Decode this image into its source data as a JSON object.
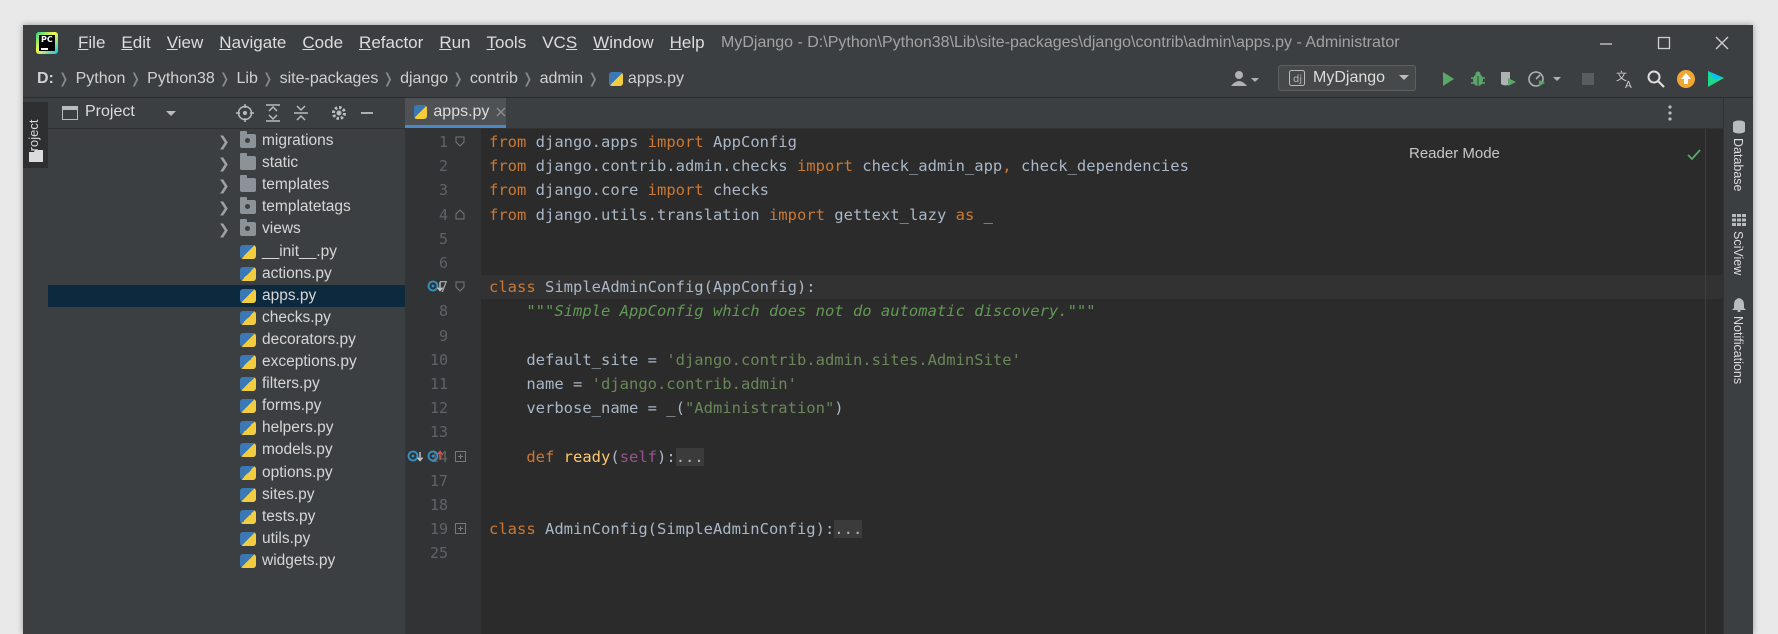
{
  "window": {
    "title": "MyDjango - D:\\Python\\Python38\\Lib\\site-packages\\django\\contrib\\admin\\apps.py - Administrator",
    "logo_text": "PC"
  },
  "menu": [
    {
      "mnemonic": "F",
      "rest": "ile"
    },
    {
      "mnemonic": "E",
      "rest": "dit"
    },
    {
      "mnemonic": "V",
      "rest": "iew"
    },
    {
      "mnemonic": "N",
      "rest": "avigate"
    },
    {
      "mnemonic": "C",
      "rest": "ode"
    },
    {
      "mnemonic": "R",
      "rest": "efactor"
    },
    {
      "mnemonic": "R",
      "rest": "un",
      "pre": ""
    },
    {
      "mnemonic": "T",
      "rest": "ools"
    },
    {
      "pre": "VC",
      "mnemonic": "S",
      "rest": ""
    },
    {
      "mnemonic": "W",
      "rest": "indow"
    },
    {
      "mnemonic": "H",
      "rest": "elp"
    }
  ],
  "breadcrumbs": [
    "D:",
    "Python",
    "Python38",
    "Lib",
    "site-packages",
    "django",
    "contrib",
    "admin",
    "apps.py"
  ],
  "run_config": {
    "label": "MyDjango"
  },
  "project_panel": {
    "title": "Project"
  },
  "left_stripe": {
    "project_label": "Project"
  },
  "tree": [
    {
      "name": "migrations",
      "type": "package"
    },
    {
      "name": "static",
      "type": "folder"
    },
    {
      "name": "templates",
      "type": "folder"
    },
    {
      "name": "templatetags",
      "type": "package"
    },
    {
      "name": "views",
      "type": "package"
    },
    {
      "name": "__init__.py",
      "type": "file"
    },
    {
      "name": "actions.py",
      "type": "file"
    },
    {
      "name": "apps.py",
      "type": "file",
      "selected": true
    },
    {
      "name": "checks.py",
      "type": "file"
    },
    {
      "name": "decorators.py",
      "type": "file"
    },
    {
      "name": "exceptions.py",
      "type": "file"
    },
    {
      "name": "filters.py",
      "type": "file"
    },
    {
      "name": "forms.py",
      "type": "file"
    },
    {
      "name": "helpers.py",
      "type": "file"
    },
    {
      "name": "models.py",
      "type": "file"
    },
    {
      "name": "options.py",
      "type": "file"
    },
    {
      "name": "sites.py",
      "type": "file"
    },
    {
      "name": "tests.py",
      "type": "file"
    },
    {
      "name": "utils.py",
      "type": "file"
    },
    {
      "name": "widgets.py",
      "type": "file"
    }
  ],
  "editor": {
    "tab": "apps.py",
    "reader_mode": "Reader Mode",
    "current_line": "7",
    "line_numbers": [
      "1",
      "2",
      "3",
      "4",
      "5",
      "6",
      "7",
      "8",
      "9",
      "10",
      "11",
      "12",
      "13",
      "14",
      "17",
      "18",
      "19",
      "25"
    ],
    "lines": [
      [
        {
          "t": "from",
          "c": "kw"
        },
        {
          "t": " django.apps "
        },
        {
          "t": "import",
          "c": "kw"
        },
        {
          "t": " AppConfig"
        }
      ],
      [
        {
          "t": "from",
          "c": "kw"
        },
        {
          "t": " django.contrib.admin.checks "
        },
        {
          "t": "import",
          "c": "kw"
        },
        {
          "t": " check_admin_app"
        },
        {
          "t": ",",
          "c": "kw"
        },
        {
          "t": " check_dependencies"
        }
      ],
      [
        {
          "t": "from",
          "c": "kw"
        },
        {
          "t": " django.core "
        },
        {
          "t": "import",
          "c": "kw"
        },
        {
          "t": " checks"
        }
      ],
      [
        {
          "t": "from",
          "c": "kw"
        },
        {
          "t": " django.utils.translation "
        },
        {
          "t": "import",
          "c": "kw"
        },
        {
          "t": " gettext_lazy "
        },
        {
          "t": "as",
          "c": "kw"
        },
        {
          "t": " _"
        }
      ],
      [],
      [],
      [
        {
          "t": "class",
          "c": "kw"
        },
        {
          "t": " SimpleAdminConfig(AppConfig):"
        }
      ],
      [
        {
          "t": "    "
        },
        {
          "t": "\"\"\"Simple AppConfig which does not do automatic discovery.\"\"\"",
          "c": "doc"
        }
      ],
      [],
      [
        {
          "t": "    default_site = "
        },
        {
          "t": "'django.contrib.admin.sites.AdminSite'",
          "c": "str"
        }
      ],
      [
        {
          "t": "    name = "
        },
        {
          "t": "'django.contrib.admin'",
          "c": "str"
        }
      ],
      [
        {
          "t": "    verbose_name = _("
        },
        {
          "t": "\"Administration\"",
          "c": "str"
        },
        {
          "t": ")"
        }
      ],
      [],
      [
        {
          "t": "    "
        },
        {
          "t": "def",
          "c": "kw"
        },
        {
          "t": " "
        },
        {
          "t": "ready",
          "c": "fn"
        },
        {
          "t": "("
        },
        {
          "t": "self",
          "c": "self"
        },
        {
          "t": "):"
        },
        {
          "t": "...",
          "c": "fold"
        }
      ],
      [],
      [],
      [
        {
          "t": "class",
          "c": "kw"
        },
        {
          "t": " AdminConfig(SimpleAdminConfig):"
        },
        {
          "t": "...",
          "c": "fold"
        }
      ],
      []
    ]
  },
  "right_stripe": [
    "Database",
    "SciView",
    "Notifications"
  ],
  "colors": {
    "accent": "#4a88c7",
    "selection": "#0d293e",
    "keyword": "#cc7832",
    "string": "#6a8759",
    "run_green": "#59a869"
  }
}
